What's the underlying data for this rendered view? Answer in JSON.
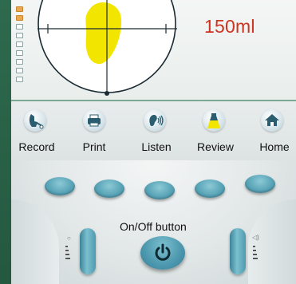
{
  "screen": {
    "volume": "150ml",
    "level_indicator": {
      "filled": 2,
      "total": 9
    }
  },
  "toolbar": {
    "items": [
      {
        "label": "Record",
        "icon": "scanner-icon"
      },
      {
        "label": "Print",
        "icon": "printer-icon"
      },
      {
        "label": "Listen",
        "icon": "ear-icon"
      },
      {
        "label": "Review",
        "icon": "lamp-icon"
      },
      {
        "label": "Home",
        "icon": "home-icon"
      }
    ]
  },
  "controls": {
    "onoff_label": "On/Off button",
    "soft_buttons": 5
  },
  "colors": {
    "frame": "#2e6a4f",
    "button": "#5aa5b8",
    "volume_text": "#cc3320",
    "bladder_fill": "#f2e600"
  }
}
